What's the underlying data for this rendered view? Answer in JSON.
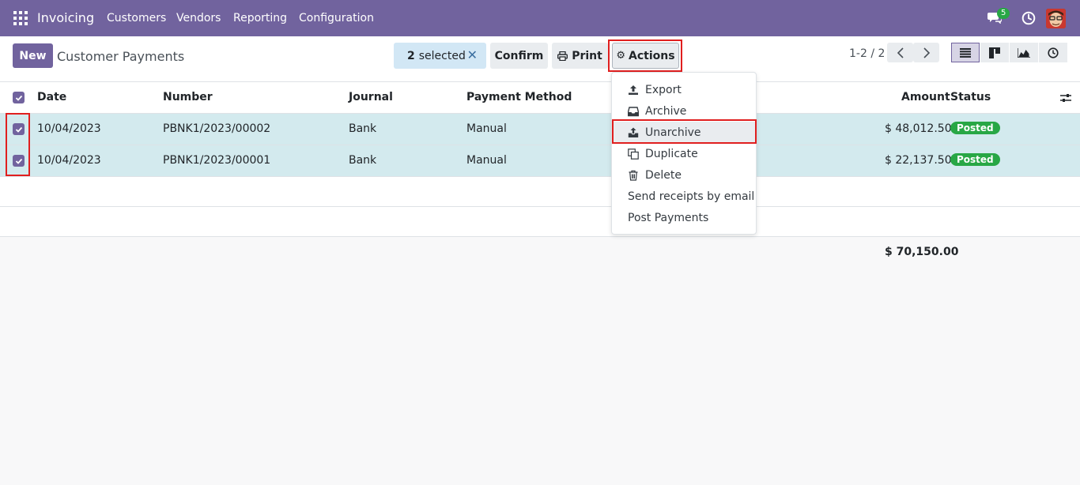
{
  "navbar": {
    "brand": "Invoicing",
    "menu": [
      "Customers",
      "Vendors",
      "Reporting",
      "Configuration"
    ],
    "chat_count": "5"
  },
  "control_panel": {
    "new_label": "New",
    "title": "Customer Payments",
    "selected_count": "2",
    "selected_suffix": "selected",
    "confirm_label": "Confirm",
    "print_label": "Print",
    "actions_label": "Actions",
    "pager": "1-2 / 2"
  },
  "table": {
    "headers": {
      "date": "Date",
      "number": "Number",
      "journal": "Journal",
      "payment_method": "Payment Method",
      "amount": "Amount",
      "status": "Status"
    },
    "rows": [
      {
        "date": "10/04/2023",
        "number": "PBNK1/2023/00002",
        "journal": "Bank",
        "method": "Manual",
        "amount": "$ 48,012.50",
        "status": "Posted"
      },
      {
        "date": "10/04/2023",
        "number": "PBNK1/2023/00001",
        "journal": "Bank",
        "method": "Manual",
        "amount": "$ 22,137.50",
        "status": "Posted"
      }
    ],
    "total": "$ 70,150.00"
  },
  "actions_menu": {
    "export": "Export",
    "archive": "Archive",
    "unarchive": "Unarchive",
    "duplicate": "Duplicate",
    "delete": "Delete",
    "send_receipts": "Send receipts by email",
    "post_payments": "Post Payments"
  },
  "colors": {
    "brand": "#71639e",
    "selected_row": "#d3eaee",
    "status_posted": "#28a745",
    "highlight": "#e01f1f"
  }
}
